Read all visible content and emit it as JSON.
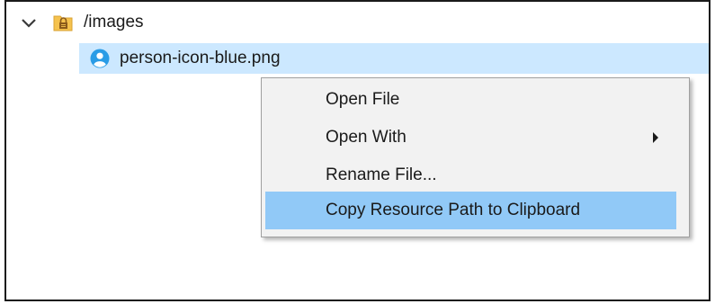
{
  "tree": {
    "folder": {
      "label": "/images",
      "icon": "locked-folder-icon",
      "expanded": true
    },
    "file": {
      "label": "person-icon-blue.png",
      "icon": "person-icon",
      "selected": true
    }
  },
  "context_menu": {
    "items": [
      {
        "label": "Open File",
        "has_submenu": false,
        "highlighted": false
      },
      {
        "label": "Open With",
        "has_submenu": true,
        "highlighted": false
      },
      {
        "label": "Rename File...",
        "has_submenu": false,
        "highlighted": false
      },
      {
        "label": "Copy Resource Path to Clipboard",
        "has_submenu": false,
        "highlighted": true
      }
    ]
  },
  "colors": {
    "selection": "#cce8ff",
    "menu_highlight": "#91c9f7",
    "menu_background": "#f2f2f2",
    "folder": "#f5c24e",
    "lock": "#8b5a1a",
    "person_icon": "#2a9ce6"
  }
}
